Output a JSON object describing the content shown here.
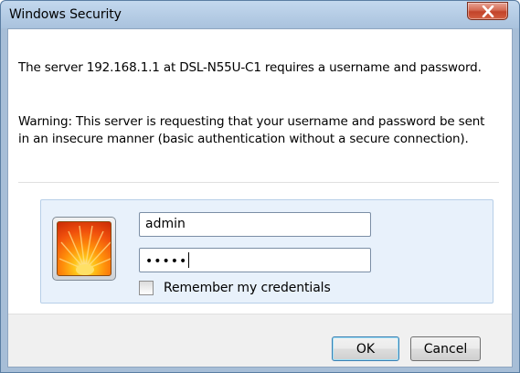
{
  "window": {
    "title": "Windows Security"
  },
  "message": {
    "line1": "The server 192.168.1.1 at DSL-N55U-C1 requires a username and password.",
    "warning": "Warning: This server is requesting that your username and password be sent in an insecure manner (basic authentication without a secure connection)."
  },
  "credentials": {
    "username": "admin",
    "password_mask": "•••••",
    "remember_label": "Remember my credentials",
    "remember_checked": false
  },
  "buttons": {
    "ok": "OK",
    "cancel": "Cancel"
  },
  "colors": {
    "titlebar": "#a9c2dd",
    "close_button": "#c2442a",
    "panel": "#e8f1fb"
  },
  "icons": {
    "close": "close-icon",
    "user_tile": "user-tile-flower"
  }
}
